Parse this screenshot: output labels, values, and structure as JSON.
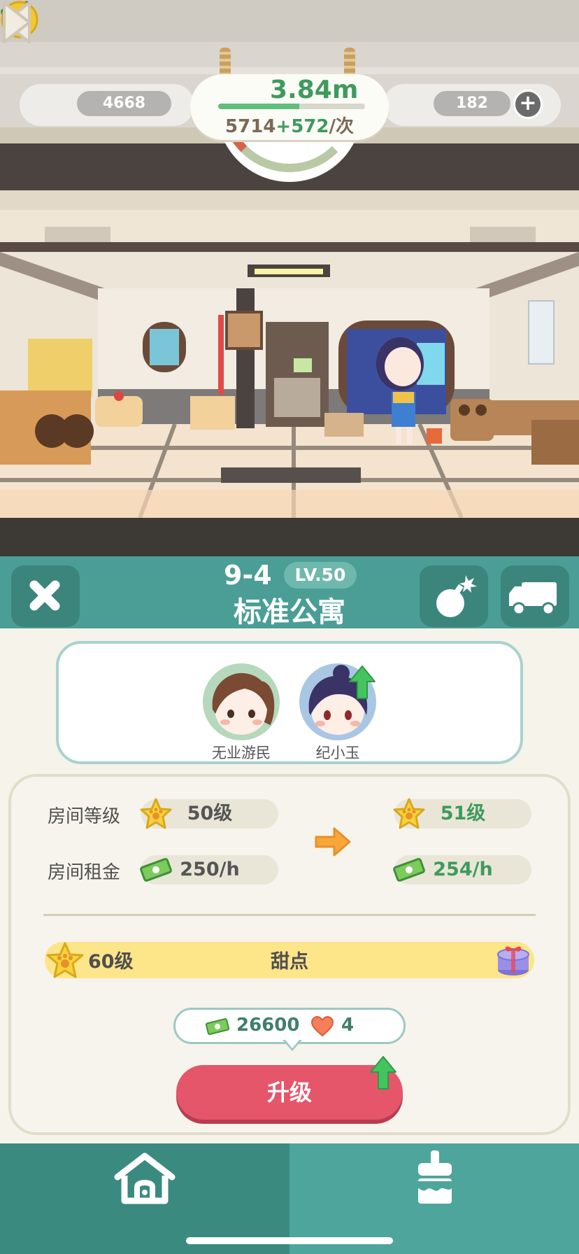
{
  "hud": {
    "stars": "4668",
    "gems": "182",
    "income_total": "3.84m",
    "income_progress": 0.55,
    "rate_base": "5714",
    "rate_bonus": "+572",
    "rate_unit": "/次",
    "mood": "neutral"
  },
  "room": {
    "code": "9-4",
    "level_badge": "LV.50",
    "name": "标准公寓"
  },
  "tenants": [
    {
      "name": "无业游民",
      "upgrade_available": false
    },
    {
      "name": "纪小玉",
      "upgrade_available": true
    }
  ],
  "stats": {
    "level_label": "房间等级",
    "level_current": "50级",
    "level_next": "51级",
    "rent_label": "房间租金",
    "rent_current": "250/h",
    "rent_next": "254/h"
  },
  "milestone": {
    "level": "60级",
    "reward": "甜点"
  },
  "cost": {
    "cash": "26600",
    "hearts": "4"
  },
  "buttons": {
    "upgrade": "升级"
  },
  "icons": {
    "close": "close-icon",
    "bomb": "bomb-icon",
    "truck": "truck-icon",
    "home": "home-icon",
    "decor": "paint-brush-icon"
  },
  "colors": {
    "teal_header": "#4a9e96",
    "upgrade_red": "#e5566a",
    "money_green": "#3f9a5d",
    "milestone_yellow": "#fde58a"
  }
}
